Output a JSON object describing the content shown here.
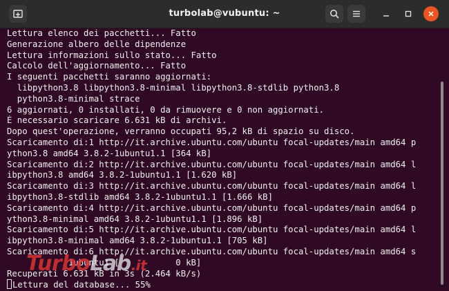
{
  "window": {
    "title": "turbolab@vubuntu: ~"
  },
  "terminal": {
    "lines": [
      "Lettura elenco dei pacchetti... Fatto",
      "Generazione albero delle dipendenze",
      "Lettura informazioni sullo stato... Fatto",
      "Calcolo dell'aggiornamento... Fatto",
      "I seguenti pacchetti saranno aggiornati:",
      "  libpython3.8 libpython3.8-minimal libpython3.8-stdlib python3.8",
      "  python3.8-minimal strace",
      "6 aggiornati, 0 installati, 0 da rimuovere e 0 non aggiornati.",
      "È necessario scaricare 6.631 kB di archivi.",
      "Dopo quest'operazione, verranno occupati 95,2 kB di spazio su disco.",
      "Scaricamento di:1 http://it.archive.ubuntu.com/ubuntu focal-updates/main amd64 p",
      "ython3.8 amd64 3.8.2-1ubuntu1.1 [364 kB]",
      "Scaricamento di:2 http://it.archive.ubuntu.com/ubuntu focal-updates/main amd64 l",
      "ibpython3.8 amd64 3.8.2-1ubuntu1.1 [1.620 kB]",
      "Scaricamento di:3 http://it.archive.ubuntu.com/ubuntu focal-updates/main amd64 l",
      "ibpython3.8-stdlib amd64 3.8.2-1ubuntu1.1 [1.666 kB]",
      "Scaricamento di:4 http://it.archive.ubuntu.com/ubuntu focal-updates/main amd64 p",
      "ython3.8-minimal amd64 3.8.2-1ubuntu1.1 [1.896 kB]",
      "Scaricamento di:5 http://it.archive.ubuntu.com/ubuntu focal-updates/main amd64 l",
      "ibpython3.8-minimal amd64 3.8.2-1ubuntu1.1 [705 kB]",
      "Scaricamento di:6 http://it.archive.ubuntu.com/ubuntu focal-updates/main amd64 s",
      "            1ubuntu1 [           0 kB]",
      "Recuperati 6.631 kB in 3s (2.464 kB/s)"
    ],
    "prompt_line": "Lettura del database... 55%"
  },
  "watermark": {
    "part1": "Turbo",
    "part2": "Lab",
    "part3": ".it"
  },
  "colors": {
    "terminal_bg": "#300a24",
    "titlebar_bg": "#2c2c2c",
    "close_button": "#e95420",
    "text": "#f0f0f0"
  },
  "icons": [
    "new-tab-icon",
    "search-icon",
    "hamburger-menu-icon",
    "minimize-icon",
    "maximize-icon",
    "close-icon"
  ]
}
